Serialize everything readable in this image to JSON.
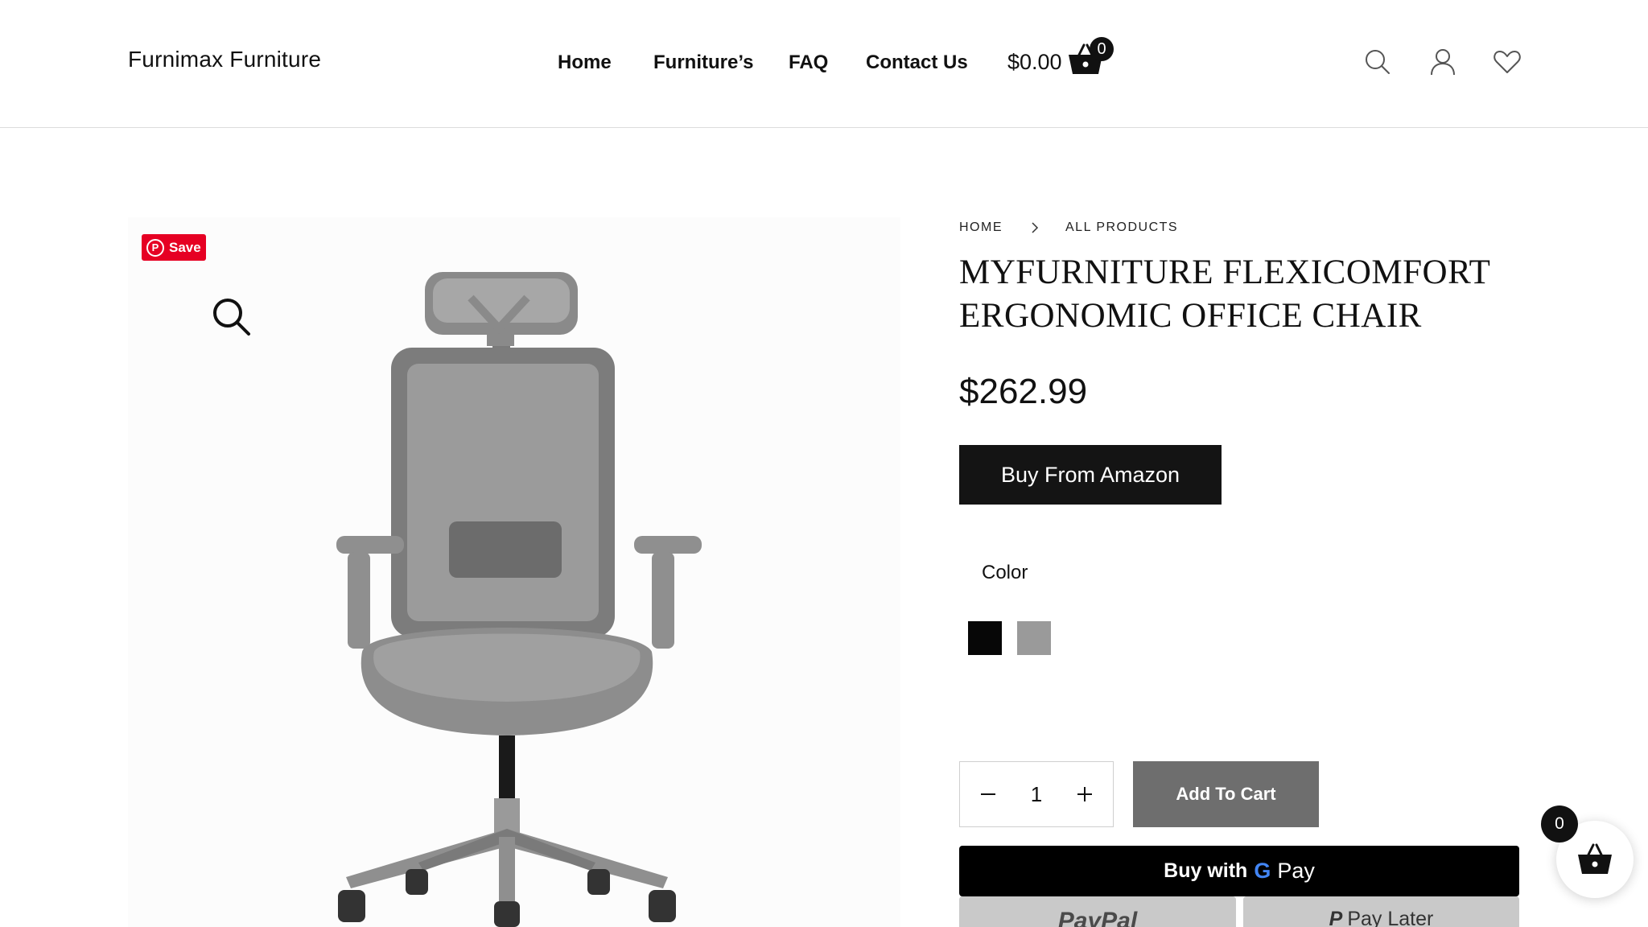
{
  "header": {
    "logo": "Furnimax Furniture",
    "nav": {
      "home": "Home",
      "furniture": "Furniture’s",
      "faq": "FAQ",
      "contact": "Contact Us"
    },
    "cart_amount": "$0.00",
    "cart_count": "0",
    "icons": [
      "search-icon",
      "user-icon",
      "heart-icon",
      "basket-icon"
    ]
  },
  "gallery": {
    "pin_save_label": "Save",
    "icons": [
      "pinterest-icon",
      "zoom-icon"
    ]
  },
  "product": {
    "breadcrumb": [
      "HOME",
      "ALL PRODUCTS"
    ],
    "title": "MYFURNITURE FLEXICOMFORT ERGONOMIC OFFICE CHAIR",
    "price": "$262.99",
    "amazon_button": "Buy From Amazon",
    "color_label": "Color",
    "colors": [
      {
        "name": "black",
        "hex": "#070707"
      },
      {
        "name": "grey",
        "hex": "#9a9a9a"
      }
    ],
    "quantity": "1",
    "add_to_cart": "Add To Cart",
    "gpay": {
      "buy_with": "Buy with",
      "g": "G",
      "pay": "Pay"
    },
    "paypal": "PayPal",
    "pay_later": "Pay Later"
  },
  "floating_cart": {
    "count": "0"
  },
  "colors": {
    "primary_dark": "#141414",
    "add_to_cart_bg": "#6e6e6e",
    "pinterest_red": "#e60023"
  }
}
